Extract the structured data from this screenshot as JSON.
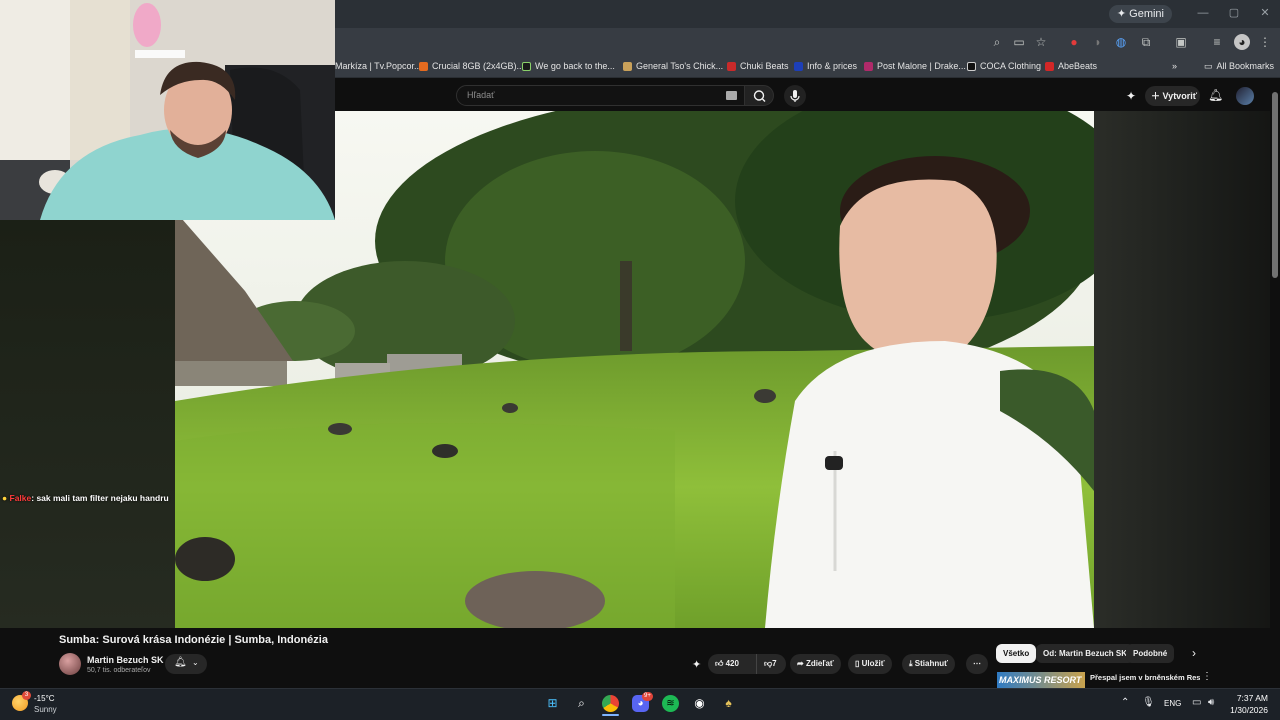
{
  "browser": {
    "gemini_label": "Gemini",
    "bookmarks": [
      {
        "label": "Markíza | Tv.Popcor...",
        "color": "#2a5db0"
      },
      {
        "label": "Crucial 8GB (2x4GB)...",
        "color": "#e56b1f"
      },
      {
        "label": "We go back to the...",
        "color": "#1a1a1a"
      },
      {
        "label": "General Tso's Chick...",
        "color": "#c9a15a"
      },
      {
        "label": "Chuki Beats",
        "color": "#c92a2a"
      },
      {
        "label": "Info & prices",
        "color": "#1d3fb8"
      },
      {
        "label": "Post Malone | Drake...",
        "color": "#b02a6a"
      },
      {
        "label": "COCA Clothing",
        "color": "#111111"
      },
      {
        "label": "AbeBeats",
        "color": "#d42727"
      }
    ],
    "all_bookmarks_label": "All Bookmarks"
  },
  "youtube": {
    "search_placeholder": "Hľadať",
    "create_label": "Vytvoriť",
    "video_title": "Sumba: Surová krása Indonézie | Sumba, Indonézia",
    "channel_name": "Martin Bezuch SK",
    "subscribers": "50,7 tis. odberateľov",
    "likes": "420",
    "dislikes": "7",
    "share_label": "Zdieľať",
    "save_label": "Uložiť",
    "download_label": "Stiahnuť",
    "chips": [
      "Všetko",
      "Od: Martin Bezuch SK",
      "Podobné"
    ],
    "rec_thumb_text": "MAXIMUS RESORT BRNO",
    "rec_title": "Přespal jsem v brněnském Resortu Maximus | Bez obcub"
  },
  "chat": {
    "user": "Falke",
    "message": ": sak mali tam filter nejaku handru"
  },
  "taskbar": {
    "temperature": "-15°C",
    "condition": "Sunny",
    "weather_badge": "3",
    "language": "ENG",
    "time": "7:37 AM",
    "date": "1/30/2026",
    "discord_badge": "9+"
  }
}
